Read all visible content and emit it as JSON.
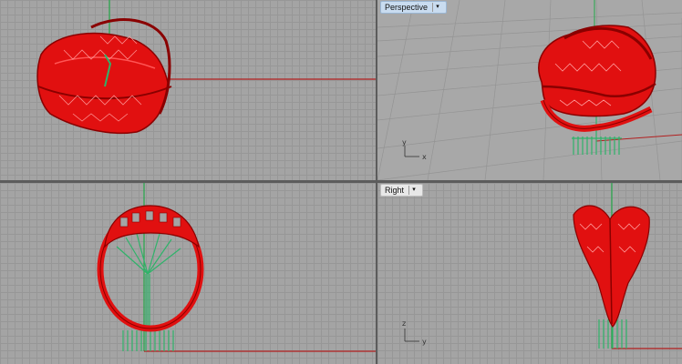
{
  "viewports": {
    "top": {
      "label": ""
    },
    "perspective": {
      "label": "Perspective",
      "active": true
    },
    "front": {
      "label": ""
    },
    "right": {
      "label": "Right"
    }
  },
  "axis_labels": {
    "perspective_y": "y",
    "perspective_x": "x",
    "right_z": "z",
    "right_y": "y"
  },
  "colors": {
    "model": "#e11010",
    "model_dark": "#8a0000",
    "support": "#2fb36a",
    "x_axis": "#b21f1f",
    "y_axis": "#25a84a"
  },
  "icons": {
    "dropdown": "chevron-down-icon"
  }
}
